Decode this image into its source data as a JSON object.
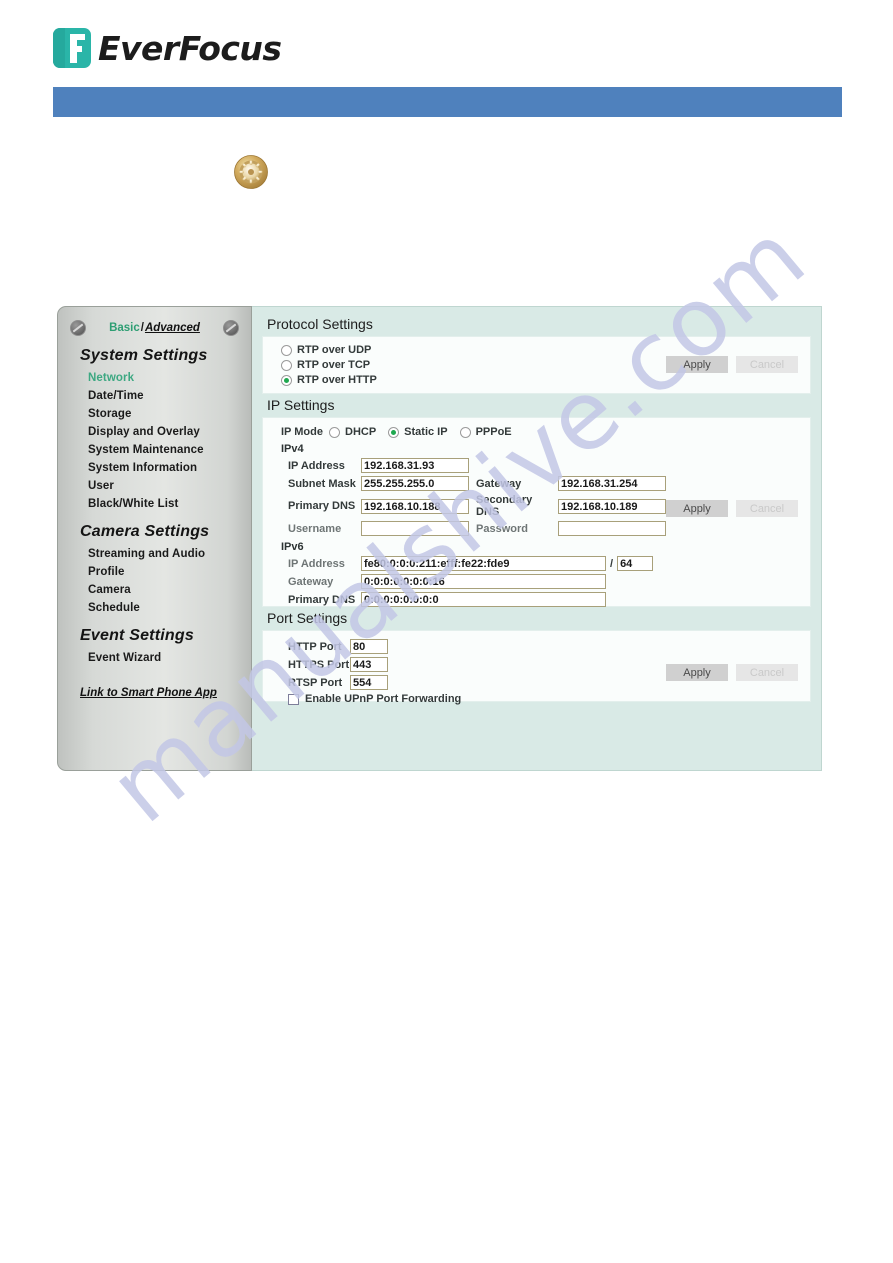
{
  "brand": {
    "name": "EverFocus",
    "logo_color": "#2ab5a8",
    "header_bar_color": "#4f81bd"
  },
  "bullet": {
    "icon": "gear-icon",
    "color": "#c8a44a"
  },
  "sidebar": {
    "mode": {
      "basic_label": "Basic",
      "separator": "/",
      "advanced_label": "Advanced",
      "basic_color": "#2e9e73"
    },
    "groups": [
      {
        "title": "System Settings",
        "items": [
          {
            "label": "Network",
            "active": true
          },
          {
            "label": "Date/Time",
            "active": false
          },
          {
            "label": "Storage",
            "active": false
          },
          {
            "label": "Display and Overlay",
            "active": false
          },
          {
            "label": "System Maintenance",
            "active": false
          },
          {
            "label": "System Information",
            "active": false
          },
          {
            "label": "User",
            "active": false
          },
          {
            "label": "Black/White List",
            "active": false
          }
        ]
      },
      {
        "title": "Camera Settings",
        "items": [
          {
            "label": "Streaming and Audio",
            "active": false
          },
          {
            "label": "Profile",
            "active": false
          },
          {
            "label": "Camera",
            "active": false
          },
          {
            "label": "Schedule",
            "active": false
          }
        ]
      },
      {
        "title": "Event Settings",
        "items": [
          {
            "label": "Event Wizard",
            "active": false
          }
        ]
      }
    ],
    "smartphone_link": "Link to Smart Phone App"
  },
  "protocol": {
    "title": "Protocol Settings",
    "options": [
      {
        "label": "RTP over UDP",
        "selected": false
      },
      {
        "label": "RTP over TCP",
        "selected": false
      },
      {
        "label": "RTP over HTTP",
        "selected": true
      }
    ],
    "apply_label": "Apply",
    "cancel_label": "Cancel"
  },
  "ip": {
    "title": "IP Settings",
    "mode_label": "IP Mode",
    "modes": [
      {
        "label": "DHCP",
        "selected": false
      },
      {
        "label": "Static IP",
        "selected": true
      },
      {
        "label": "PPPoE",
        "selected": false
      }
    ],
    "ipv4": {
      "heading": "IPv4",
      "ip_address_label": "IP Address",
      "ip_address_value": "192.168.31.93",
      "subnet_mask_label": "Subnet Mask",
      "subnet_mask_value": "255.255.255.0",
      "gateway_label": "Gateway",
      "gateway_value": "192.168.31.254",
      "primary_dns_label": "Primary DNS",
      "primary_dns_value": "192.168.10.188",
      "secondary_dns_label": "Secondary DNS",
      "secondary_dns_value": "192.168.10.189",
      "username_label": "Username",
      "username_value": "",
      "password_label": "Password",
      "password_value": ""
    },
    "ipv6": {
      "heading": "IPv6",
      "ip_address_label": "IP Address",
      "ip_address_value": "fe80:0:0:0:211:efff:fe22:fde9",
      "prefix_separator": "/",
      "prefix_value": "64",
      "gateway_label": "Gateway",
      "gateway_value": "0:0:0:0:0:0:0:16",
      "primary_dns_label": "Primary DNS",
      "primary_dns_value": "0:0:0:0:0:0:0:0"
    },
    "apply_label": "Apply",
    "cancel_label": "Cancel"
  },
  "port": {
    "title": "Port Settings",
    "http_label": "HTTP Port",
    "http_value": "80",
    "https_label": "HTTPS Port",
    "https_value": "443",
    "rtsp_label": "RTSP Port",
    "rtsp_value": "554",
    "upnp_label": "Enable UPnP Port Forwarding",
    "upnp_checked": false,
    "apply_label": "Apply",
    "cancel_label": "Cancel"
  },
  "watermark": {
    "text": "manualshive.com",
    "color": "#c3c7e6"
  }
}
